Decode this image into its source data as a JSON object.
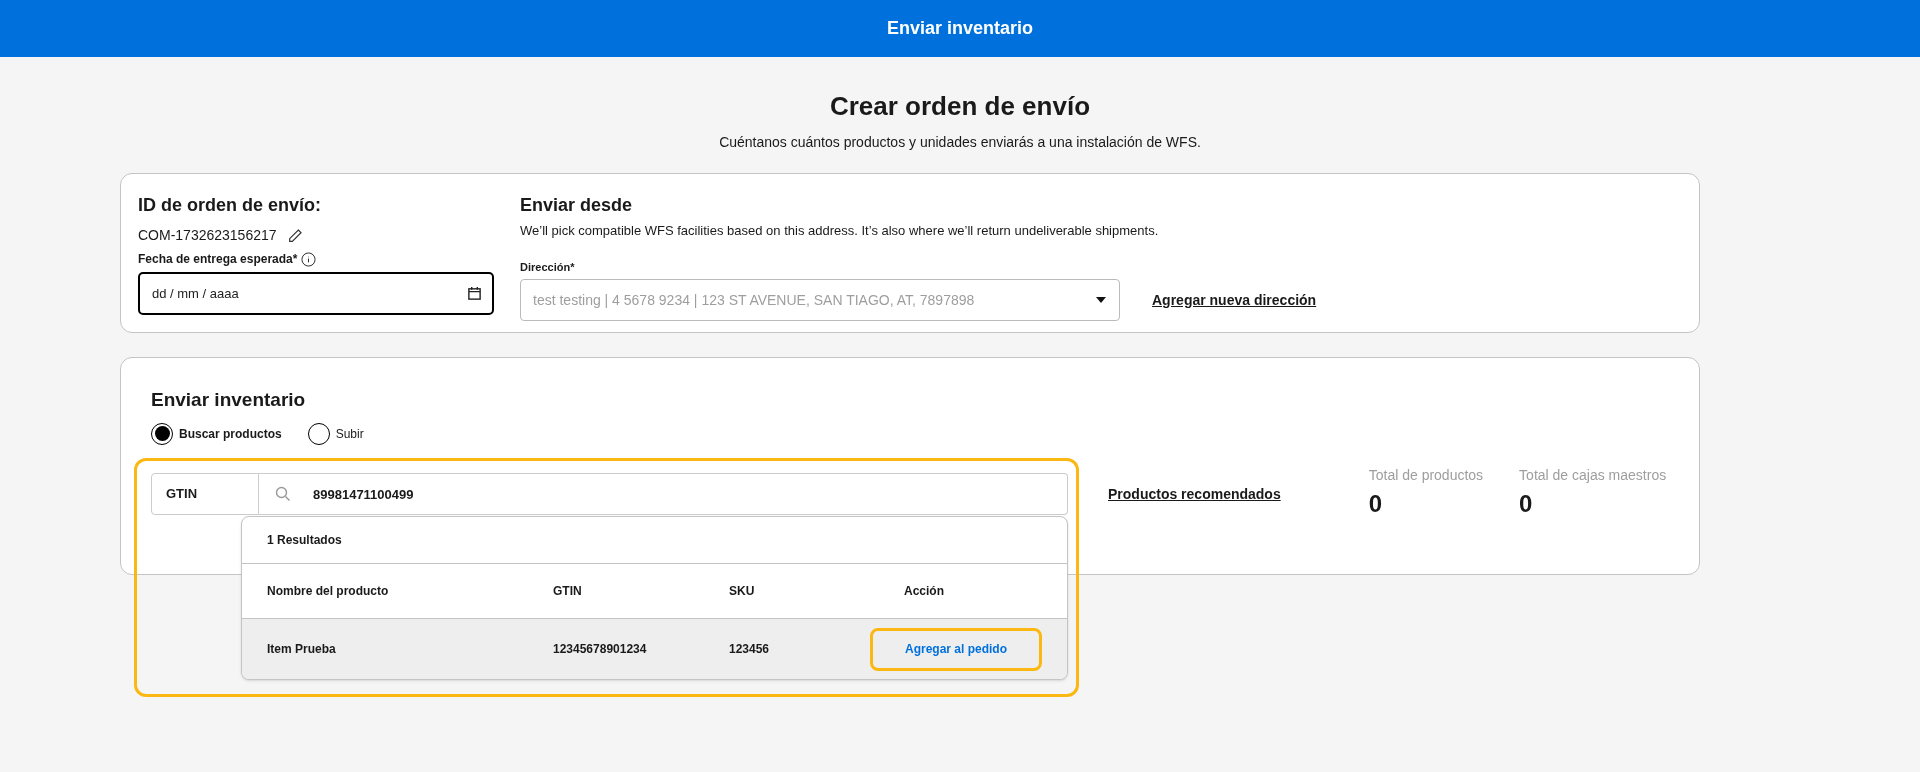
{
  "header": {
    "title": "Enviar inventario"
  },
  "page": {
    "title": "Crear orden de envío",
    "subtitle": "Cuéntanos cuántos productos y unidades enviarás a una instalación de WFS."
  },
  "order": {
    "id_label": "ID de orden de envío:",
    "id_value": "COM-1732623156217",
    "date_label": "Fecha de entrega esperada*",
    "date_placeholder": "dd / mm / aaaa"
  },
  "ship_from": {
    "title": "Enviar desde",
    "description": "We’ll pick compatible WFS facilities based on this address. It’s also where we’ll return undeliverable shipments.",
    "address_label": "Dirección*",
    "address_value": "test testing | 4 5678 9234 | 123 ST AVENUE, SAN TIAGO, AT, 7897898",
    "add_link": "Agregar nueva dirección"
  },
  "inventory": {
    "title": "Enviar inventario",
    "modes": [
      {
        "label": "Buscar productos",
        "selected": true
      },
      {
        "label": "Subir",
        "selected": false
      }
    ],
    "search_type": "GTIN",
    "search_value": "89981471100499",
    "results": {
      "count": "1 Resultados",
      "columns": [
        "Nombre del producto",
        "GTIN",
        "SKU",
        "Acción"
      ],
      "rows": [
        {
          "name": "Item Prueba",
          "gtin": "12345678901234",
          "sku": "123456",
          "action": "Agregar al pedido"
        }
      ]
    },
    "recommended_link": "Productos recomendados",
    "totals": [
      {
        "label": "Total de productos",
        "value": "0"
      },
      {
        "label": "Total de cajas maestros",
        "value": "0"
      }
    ]
  }
}
